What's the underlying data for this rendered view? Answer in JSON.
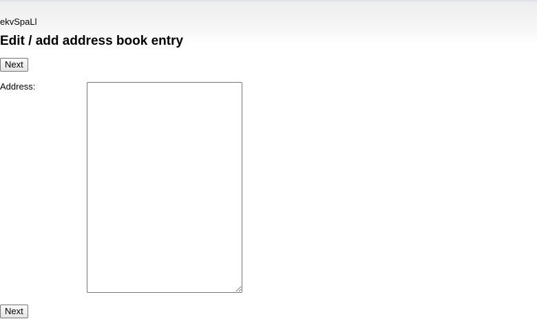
{
  "header": {
    "user_tag": "ekvSpaLl",
    "title": "Edit / add address book entry"
  },
  "form": {
    "next_top_label": "Next",
    "address_label": "Address:",
    "address_value": "",
    "next_bottom_label": "Next"
  }
}
